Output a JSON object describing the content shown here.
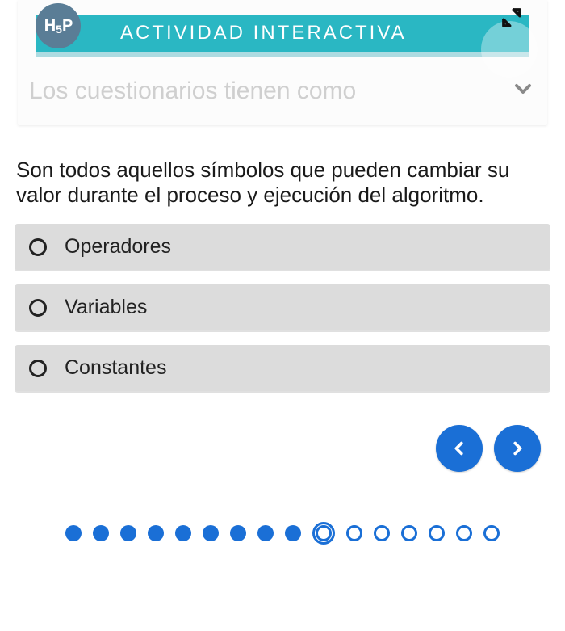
{
  "header": {
    "badge": "H5P",
    "title": "ACTIVIDAD INTERACTIVA",
    "intro_truncated": "Los cuestionarios tienen como"
  },
  "question": {
    "text": "Son todos aquellos  símbolos que pueden cambiar su valor durante el proceso y ejecución del algoritmo."
  },
  "options": [
    {
      "label": "Operadores"
    },
    {
      "label": "Variables"
    },
    {
      "label": "Constantes"
    }
  ],
  "pager": {
    "total": 16,
    "completed": 9,
    "current_index": 9
  },
  "colors": {
    "accent": "#1a6fd6",
    "banner": "#2ab7c3"
  }
}
